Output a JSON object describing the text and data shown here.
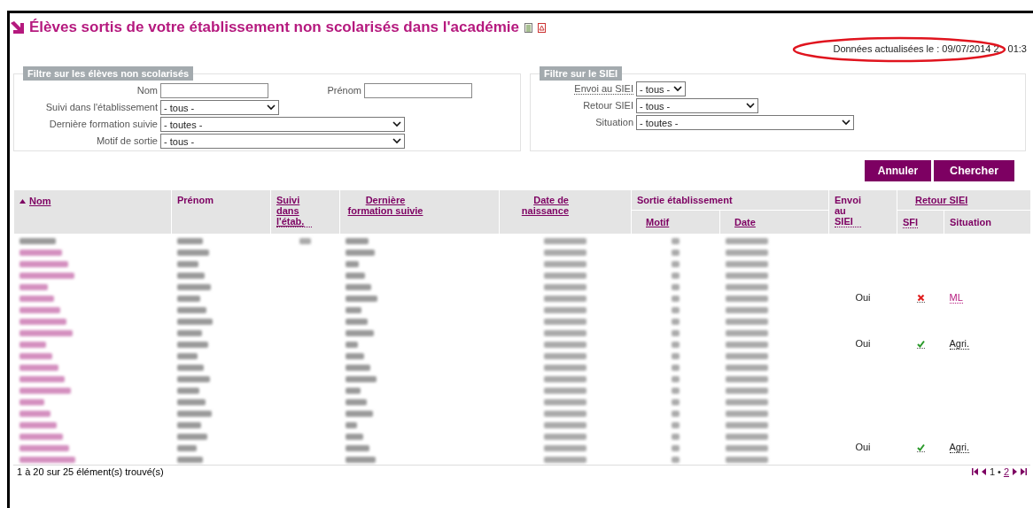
{
  "title": "Élèves sortis de votre établissement non scolarisés dans l'académie",
  "updated": [
    "Données actualisées le : 09/07/2014 2",
    "01:3"
  ],
  "filters": [
    {
      "legend": "Filtre sur les élèves non scolarisés",
      "fields": [
        {
          "kind": "text",
          "label": "Nom",
          "dotted": false
        },
        {
          "kind": "text",
          "label": "Prénom",
          "dotted": false
        },
        {
          "kind": "select",
          "label": "Suivi dans l'établissement",
          "value": "- tous -",
          "dotted": false
        },
        {
          "kind": "select",
          "label": "Dernière formation suivie",
          "value": "- toutes -",
          "dotted": false
        },
        {
          "kind": "select",
          "label": "Motif de sortie",
          "value": "- tous -",
          "dotted": false
        }
      ]
    },
    {
      "legend": "Filtre sur le SIEI",
      "fields": [
        {
          "kind": "select",
          "label": "Envoi au SIEI",
          "value": "- tous -",
          "dotted": true
        },
        {
          "kind": "select",
          "label": "Retour SIEI",
          "value": "- tous -",
          "dotted": false
        },
        {
          "kind": "select",
          "label": "Situation",
          "value": "- toutes -",
          "dotted": false
        }
      ]
    }
  ],
  "buttons": [
    "Annuler",
    "Chercher"
  ],
  "table": {
    "columns": [
      {
        "label": "Nom",
        "link": true,
        "sorted": true
      },
      {
        "label": "Prénom",
        "link": false
      },
      {
        "label": "Suivi dans l'étab.",
        "link": true
      },
      {
        "label": "Dernière formation suivie",
        "link": true
      },
      {
        "label": "Date de naissance",
        "link": true
      },
      {
        "label": "Sortie établissement",
        "link": false,
        "children": [
          {
            "label": "Motif",
            "link": true
          },
          {
            "label": "Date",
            "link": true
          }
        ]
      },
      {
        "label": "Envoi au SIEI",
        "link": false
      },
      {
        "label": "Retour SIEI",
        "link": true,
        "children": [
          {
            "label": "SFI",
            "link": false
          },
          {
            "label": "Situation",
            "link": false
          }
        ]
      }
    ],
    "rows": [
      {
        "name_link": false,
        "suivi_shown": true
      },
      {
        "name_link": true
      },
      {
        "name_link": true
      },
      {
        "name_link": true
      },
      {
        "name_link": true
      },
      {
        "name_link": true,
        "envoi": "Oui",
        "sfi_ok": false,
        "situation": {
          "text": "ML",
          "kind": "link"
        }
      },
      {
        "name_link": true
      },
      {
        "name_link": true
      },
      {
        "name_link": true
      },
      {
        "name_link": true,
        "envoi": "Oui",
        "sfi_ok": true,
        "situation": {
          "text": "Agri.",
          "kind": "abbr"
        }
      },
      {
        "name_link": true
      },
      {
        "name_link": true
      },
      {
        "name_link": true
      },
      {
        "name_link": true
      },
      {
        "name_link": true
      },
      {
        "name_link": true
      },
      {
        "name_link": true
      },
      {
        "name_link": true
      },
      {
        "name_link": true,
        "envoi": "Oui",
        "sfi_ok": true,
        "situation": {
          "text": "Agri.",
          "kind": "abbr"
        }
      },
      {
        "name_link": true
      }
    ]
  },
  "footer": {
    "summary": "1 à 20 sur 25 élément(s) trouvé(s)",
    "pages": [
      {
        "label": "1",
        "selected": true
      },
      {
        "label": "2",
        "selected": false
      }
    ],
    "separator": "•"
  }
}
